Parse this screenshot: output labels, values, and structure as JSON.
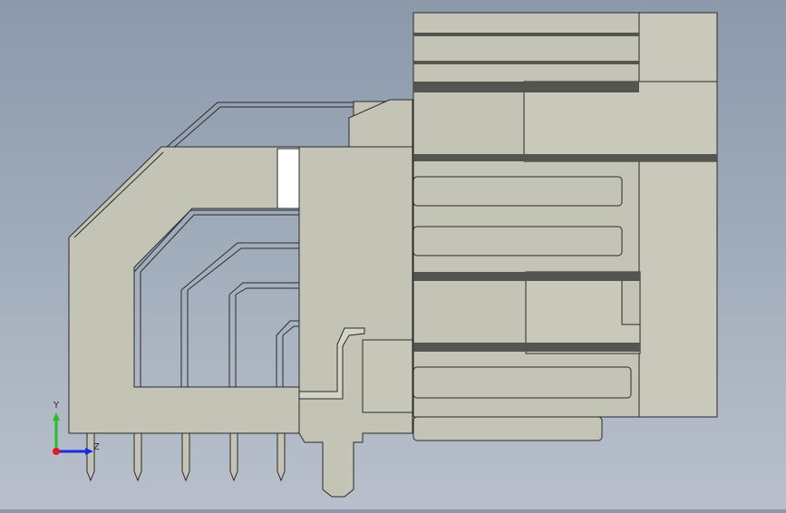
{
  "viewport": {
    "background_top": "#8b99ab",
    "background_bottom": "#b9c0cc",
    "body_color": "#c4c4b6",
    "edge_color": "#2a2a2a",
    "shadow_color": "#555550"
  },
  "triad": {
    "y_label": "Y",
    "z_label": "Z",
    "y_color": "#22c02a",
    "z_color": "#1a2ae0",
    "origin_color": "#e01a1a"
  }
}
